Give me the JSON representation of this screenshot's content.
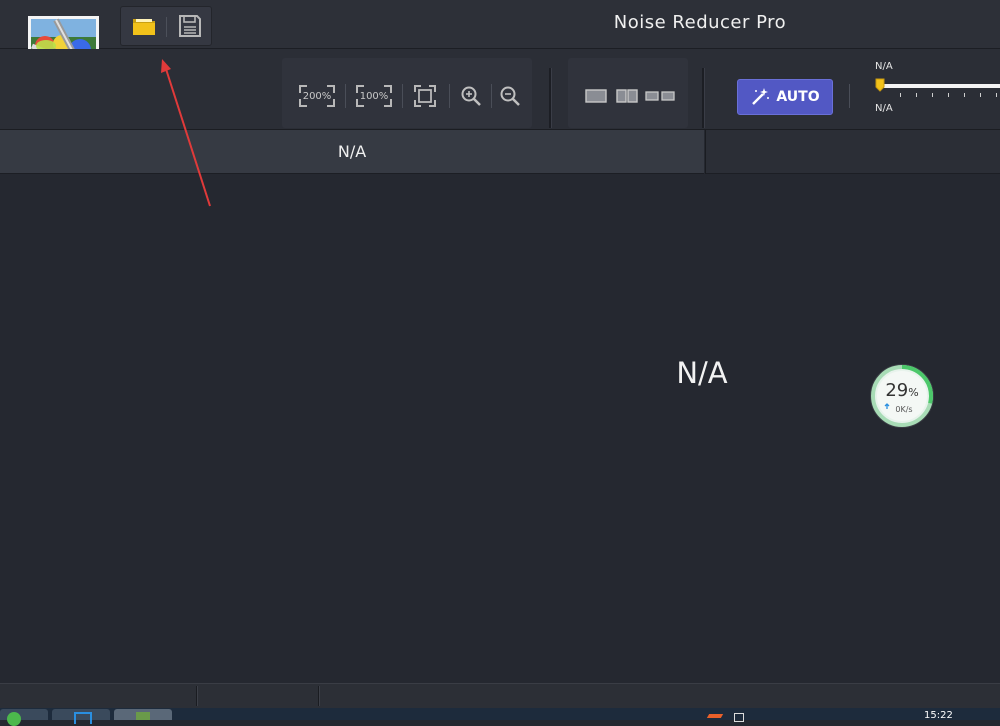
{
  "window": {
    "title": "Noise Reducer Pro"
  },
  "toolbar": {
    "zoom_200_label": "200%",
    "zoom_100_label": "100%",
    "auto_label": "AUTO",
    "slider_top_label": "N/A",
    "slider_bottom_label": "N/A"
  },
  "panel": {
    "header_label": "N/A"
  },
  "main": {
    "label": "N/A"
  },
  "gauge": {
    "percent_value": "29",
    "percent_sign": "%",
    "speed_label": "0K/s",
    "progress": 0.29
  },
  "taskbar": {
    "clock": "15:22"
  },
  "colors": {
    "accent": "#5258c4",
    "folder": "#f2c21a",
    "gauge_ring": "#4cc86a",
    "annotation_arrow": "#e03a3a"
  },
  "icons": [
    "app-logo-icon",
    "open-folder-icon",
    "save-icon",
    "fit-screen-icon",
    "zoom-in-icon",
    "zoom-out-icon",
    "single-view-icon",
    "split-view-icon",
    "compare-view-icon",
    "magic-wand-icon",
    "upload-arrow-icon"
  ]
}
